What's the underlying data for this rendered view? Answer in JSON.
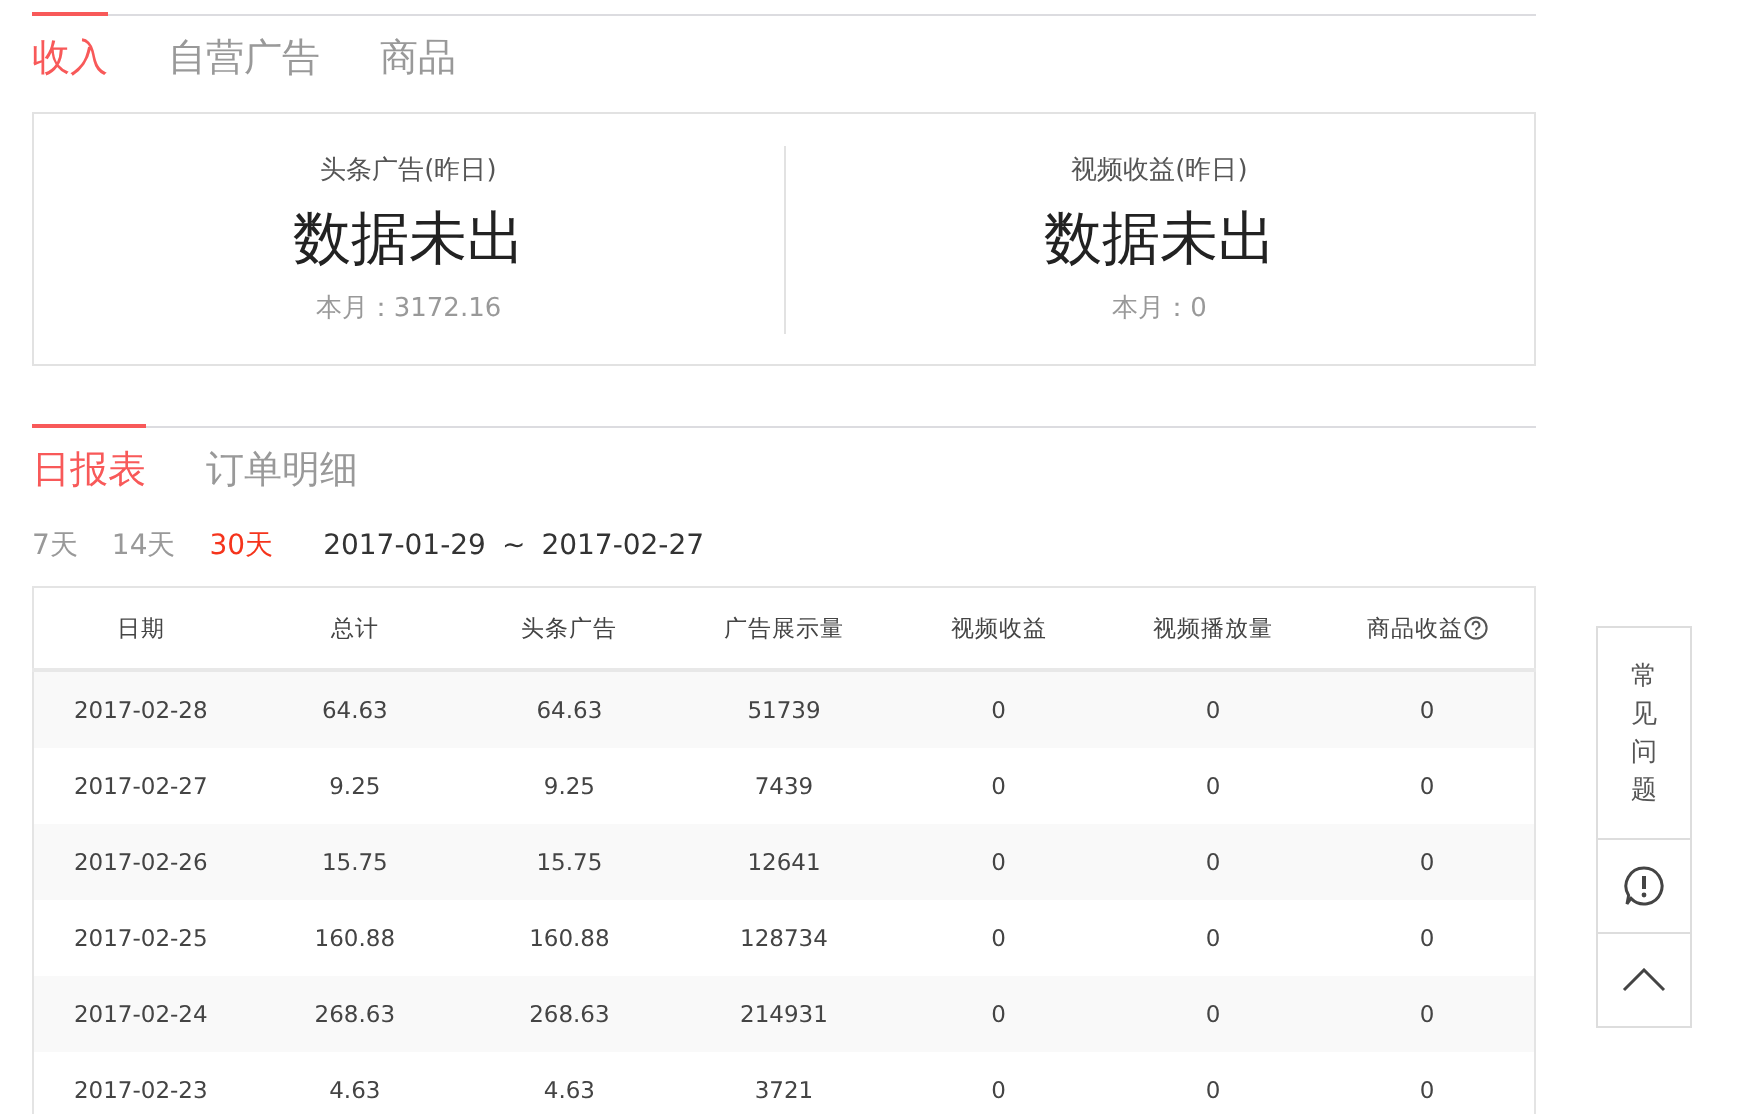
{
  "top_tabs": [
    {
      "label": "收入",
      "selected": true
    },
    {
      "label": "自营广告",
      "selected": false
    },
    {
      "label": "商品",
      "selected": false
    }
  ],
  "summary": [
    {
      "title": "头条广告(昨日)",
      "value": "数据未出",
      "month": "本月：3172.16"
    },
    {
      "title": "视频收益(昨日)",
      "value": "数据未出",
      "month": "本月：0"
    }
  ],
  "report_tabs": [
    {
      "label": "日报表",
      "selected": true
    },
    {
      "label": "订单明细",
      "selected": false
    }
  ],
  "ranges": [
    {
      "label": "7天",
      "selected": false
    },
    {
      "label": "14天",
      "selected": false
    },
    {
      "label": "30天",
      "selected": true
    }
  ],
  "date_range": {
    "start": "2017-01-29",
    "separator": "~",
    "end": "2017-02-27"
  },
  "table": {
    "columns": [
      {
        "label": "日期",
        "kind": "plain"
      },
      {
        "label": "总计",
        "kind": "plain"
      },
      {
        "label": "头条广告",
        "kind": "plain"
      },
      {
        "label": "广告展示量",
        "kind": "plain"
      },
      {
        "label": "视频收益",
        "kind": "plain"
      },
      {
        "label": "视频播放量",
        "kind": "plain"
      },
      {
        "label": "商品收益",
        "kind": "help"
      }
    ],
    "rows": [
      [
        "2017-02-28",
        "64.63",
        "64.63",
        "51739",
        "0",
        "0",
        "0"
      ],
      [
        "2017-02-27",
        "9.25",
        "9.25",
        "7439",
        "0",
        "0",
        "0"
      ],
      [
        "2017-02-26",
        "15.75",
        "15.75",
        "12641",
        "0",
        "0",
        "0"
      ],
      [
        "2017-02-25",
        "160.88",
        "160.88",
        "128734",
        "0",
        "0",
        "0"
      ],
      [
        "2017-02-24",
        "268.63",
        "268.63",
        "214931",
        "0",
        "0",
        "0"
      ],
      [
        "2017-02-23",
        "4.63",
        "4.63",
        "3721",
        "0",
        "0",
        "0"
      ]
    ]
  },
  "side_float": {
    "faq": "常见问题"
  }
}
